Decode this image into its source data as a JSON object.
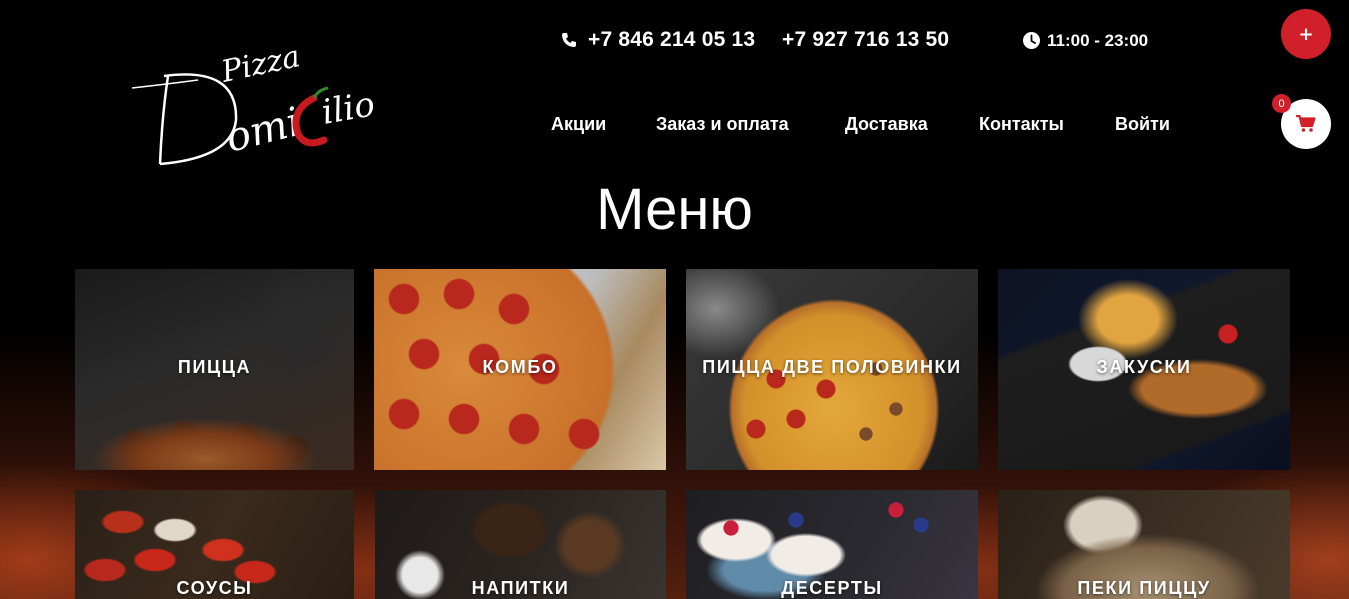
{
  "brand": {
    "logo_word_small": "Pizza",
    "logo_word_large": "Domicilio"
  },
  "header": {
    "phone_1": "+7 846 214 05 13",
    "phone_2": "+7 927 716 13 50",
    "hours": "11:00 - 23:00"
  },
  "nav": {
    "items": [
      {
        "label": "Акции"
      },
      {
        "label": "Заказ и оплата"
      },
      {
        "label": "Доставка"
      },
      {
        "label": "Контакты"
      },
      {
        "label": "Войти"
      }
    ]
  },
  "actions": {
    "plus_label": "+",
    "cart_count": "0"
  },
  "page": {
    "title": "Меню"
  },
  "menu": {
    "tiles": [
      {
        "label": "ПИЦЦА"
      },
      {
        "label": "КОМБО"
      },
      {
        "label": "ПИЦЦА ДВЕ ПОЛОВИНКИ"
      },
      {
        "label": "ЗАКУСКИ"
      },
      {
        "label": "СОУСЫ"
      },
      {
        "label": "НАПИТКИ"
      },
      {
        "label": "ДЕСЕРТЫ"
      },
      {
        "label": "ПЕКИ ПИЦЦУ"
      }
    ]
  },
  "colors": {
    "accent": "#d1202a",
    "background": "#000000",
    "text": "#ffffff"
  },
  "icons": {
    "phone": "phone-icon",
    "clock": "clock-icon",
    "cart": "cart-icon",
    "plus": "plus-icon"
  }
}
